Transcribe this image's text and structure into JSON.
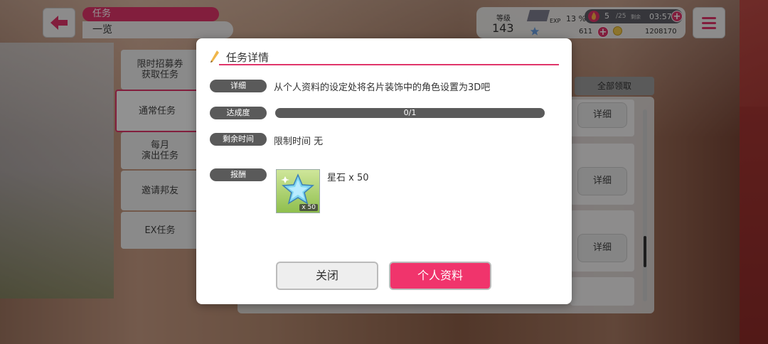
{
  "header": {
    "title": "任务",
    "subtitle": "一览",
    "back_icon": "arrow-left-icon",
    "menu_icon": "hamburger-icon"
  },
  "status": {
    "level_label": "等级",
    "level_value": "143",
    "exp_label": "EXP",
    "exp_percent": "13 %",
    "energy_current": "5",
    "energy_max": "/25",
    "remaining_label": "剩余",
    "remaining_time": "03:57",
    "star_count": "611",
    "coin_count": "1208170"
  },
  "tabs": [
    {
      "label": "限时招募券\n获取任务"
    },
    {
      "label": "通常任务"
    },
    {
      "label": "每月\n演出任务"
    },
    {
      "label": "邀请邦友"
    },
    {
      "label": "EX任务"
    }
  ],
  "list": {
    "claim_all_label": "全部领取",
    "detail_label": "详细"
  },
  "modal": {
    "title": "任务详情",
    "detail_label": "详细",
    "detail_text": "从个人资料的设定处将名片装饰中的角色设置为3D吧",
    "progress_label": "达成度",
    "progress_text": "0/1",
    "progress_fraction": 0,
    "remaining_label": "剩余时间",
    "remaining_text": "限制时间 无",
    "reward_label": "报酬",
    "reward_name": "星石 x 50",
    "reward_qty_badge": "x 50",
    "close_label": "关闭",
    "profile_label": "个人资料"
  },
  "colors": {
    "accent": "#e0356a",
    "pill_gray": "#5a5a5a"
  }
}
